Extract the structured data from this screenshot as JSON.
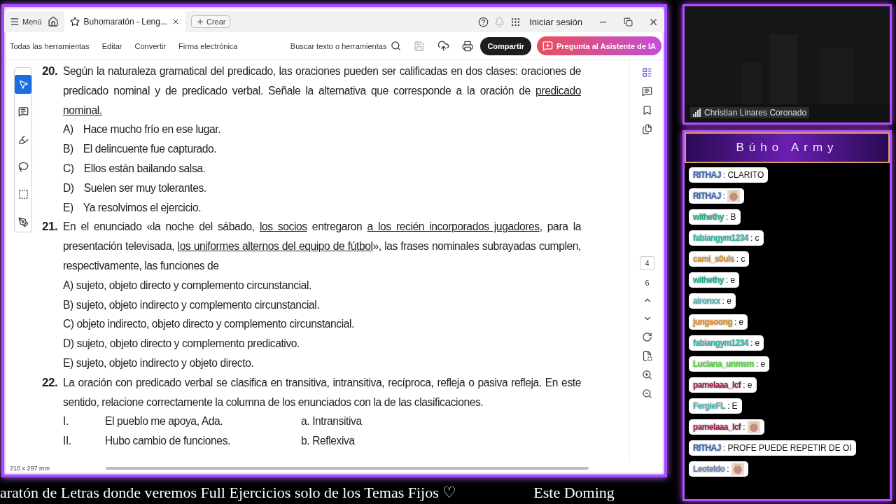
{
  "app": {
    "menu_label": "Menú",
    "tabs": [
      {
        "label": "Buhomaratón - Leng...",
        "selected": true
      }
    ],
    "new_button": "Crear",
    "sign_in": "Iniciar sesión",
    "toolbar": {
      "menus": [
        "Todas las herramientas",
        "Editar",
        "Convertir",
        "Firma electrónica"
      ],
      "search": "Buscar texto o herramientas",
      "share": "Compartir",
      "ai_button": "Pregunta al Asistente de IA"
    },
    "tools": [
      {
        "kind": "select",
        "selected": true
      },
      {
        "kind": "comment",
        "selected": false
      },
      {
        "kind": "highlight",
        "selected": false
      },
      {
        "kind": "draw",
        "selected": false
      },
      {
        "kind": "text",
        "selected": false
      },
      {
        "kind": "sign",
        "selected": false
      }
    ],
    "page_nav": {
      "current": "4",
      "total": "6"
    },
    "page_size": "210 x 297 mm"
  },
  "document": {
    "questions": [
      {
        "number": "20.",
        "text": [
          {
            "text": "Según la naturaleza gramatical del predicado, las oraciones pueden ser calificadas en dos clases: oraciones de predicado nominal y de predicado verbal. Señale la alternativa que corresponde a la oración de ",
            "underlined": false
          },
          {
            "text": "predicado nominal.",
            "underlined": true
          }
        ],
        "options": [
          {
            "letter": "A)",
            "text": "Hace mucho frío en ese lugar."
          },
          {
            "letter": "B)",
            "text": "El delincuente fue capturado."
          },
          {
            "letter": "C)",
            "text": "Ellos están bailando salsa."
          },
          {
            "letter": "D)",
            "text": "Suelen ser muy tolerantes."
          },
          {
            "letter": "E)",
            "text": "Ya resolvimos el ejercicio."
          }
        ]
      },
      {
        "number": "21.",
        "text": [
          {
            "text": "En el enunciado «la noche del sábado, ",
            "underlined": false
          },
          {
            "text": "los socios",
            "underlined": true
          },
          {
            "text": " entregaron ",
            "underlined": false
          },
          {
            "text": "a los recién incorporados jugadores",
            "underlined": true
          },
          {
            "text": ", para la presentación televisada, ",
            "underlined": false
          },
          {
            "text": "los uniformes alternos del equipo de fútbol",
            "underlined": true
          },
          {
            "text": "», las frases nominales subrayadas cumplen, respectivamente, las funciones de",
            "underlined": false
          }
        ],
        "options": [
          {
            "text": "A) sujeto, objeto directo y complemento circunstancial."
          },
          {
            "text": "B) sujeto, objeto indirecto y complemento circunstancial."
          },
          {
            "text": "C) objeto indirecto, objeto directo y complemento circunstancial."
          },
          {
            "text": "D) sujeto, objeto directo y complemento predicativo."
          },
          {
            "text": "E) sujeto, objeto indirecto y objeto directo."
          }
        ]
      },
      {
        "number": "22.",
        "text": [
          {
            "text": "La oración con predicado verbal se clasifica en transitiva, intransitiva, recíproca, refleja o pasiva refleja. En este sentido, relacione correctamente la columna de los enunciados con la de las clasificaciones.",
            "underlined": false
          }
        ],
        "pairs": [
          {
            "numeral": "I.",
            "sentence": "El pueblo me apoya, Ada.",
            "choice": "a. Intransitiva"
          },
          {
            "numeral": "II.",
            "sentence": "Hubo cambio de funciones.",
            "choice": "b. Reflexiva"
          }
        ]
      }
    ]
  },
  "camera": {
    "name": "Christian Linares Coronado"
  },
  "chat": {
    "title": "Búho Army",
    "messages": [
      {
        "user": "RITHAJ",
        "color": "#2f5fb3",
        "kind": "text",
        "text": ": CLARITO"
      },
      {
        "user": "RITHAJ",
        "color": "#2f5fb3",
        "kind": "emote",
        "text": ":"
      },
      {
        "user": "withethy",
        "color": "#1faa8a",
        "kind": "text",
        "text": ": B"
      },
      {
        "user": "fabiangym1234",
        "color": "#2ab3a0",
        "kind": "text",
        "text": ": c"
      },
      {
        "user": "cami_s0uls",
        "color": "#d98a1e",
        "kind": "text",
        "text": ": c"
      },
      {
        "user": "withethy",
        "color": "#1faa8a",
        "kind": "text",
        "text": ": e"
      },
      {
        "user": "aironxx",
        "color": "#4bb0b0",
        "kind": "text",
        "text": ": e"
      },
      {
        "user": "jungsoong",
        "color": "#d98a1e",
        "kind": "text",
        "text": ": e"
      },
      {
        "user": "fabiangym1234",
        "color": "#2ab3a0",
        "kind": "text",
        "text": ": e"
      },
      {
        "user": "Luciana_unmsm",
        "color": "#4fd13a",
        "kind": "text",
        "text": ": e"
      },
      {
        "user": "pamelaaa_lcf",
        "color": "#a0123a",
        "kind": "text",
        "text": ": e"
      },
      {
        "user": "FergieFL",
        "color": "#4fb0b0",
        "kind": "text",
        "text": ": E"
      },
      {
        "user": "pamelaaa_lcf",
        "color": "#a0123a",
        "kind": "emote",
        "text": ":"
      },
      {
        "user": "RITHAJ",
        "color": "#2f5fb3",
        "kind": "text",
        "text": ": PROFE PUEDE REPETIR DE OI"
      },
      {
        "user": "Leoteldo",
        "color": "#6a80b0",
        "kind": "emote",
        "text": ":"
      }
    ]
  },
  "ticker": [
    "aratón de Letras donde veremos Full Ejercicios solo de los Temas Fijos ♡",
    "Este Doming"
  ]
}
